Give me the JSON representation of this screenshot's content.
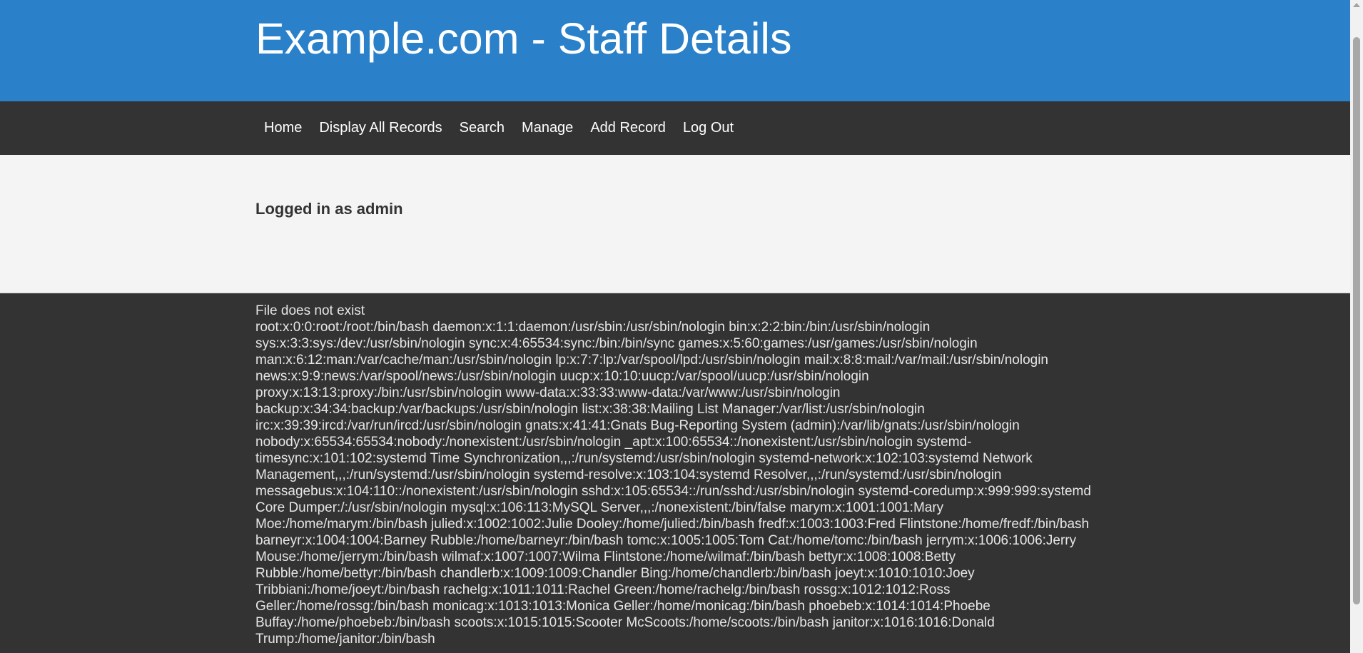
{
  "header": {
    "title": "Example.com - Staff Details"
  },
  "nav": {
    "items": [
      {
        "label": "Home"
      },
      {
        "label": "Display All Records"
      },
      {
        "label": "Search"
      },
      {
        "label": "Manage"
      },
      {
        "label": "Add Record"
      },
      {
        "label": "Log Out"
      }
    ]
  },
  "status": {
    "logged_in": "Logged in as admin"
  },
  "content": {
    "message": "File does not exist",
    "file_text": "root:x:0:0:root:/root:/bin/bash daemon:x:1:1:daemon:/usr/sbin:/usr/sbin/nologin bin:x:2:2:bin:/bin:/usr/sbin/nologin sys:x:3:3:sys:/dev:/usr/sbin/nologin sync:x:4:65534:sync:/bin:/bin/sync games:x:5:60:games:/usr/games:/usr/sbin/nologin man:x:6:12:man:/var/cache/man:/usr/sbin/nologin lp:x:7:7:lp:/var/spool/lpd:/usr/sbin/nologin mail:x:8:8:mail:/var/mail:/usr/sbin/nologin news:x:9:9:news:/var/spool/news:/usr/sbin/nologin uucp:x:10:10:uucp:/var/spool/uucp:/usr/sbin/nologin proxy:x:13:13:proxy:/bin:/usr/sbin/nologin www-data:x:33:33:www-data:/var/www:/usr/sbin/nologin backup:x:34:34:backup:/var/backups:/usr/sbin/nologin list:x:38:38:Mailing List Manager:/var/list:/usr/sbin/nologin irc:x:39:39:ircd:/var/run/ircd:/usr/sbin/nologin gnats:x:41:41:Gnats Bug-Reporting System (admin):/var/lib/gnats:/usr/sbin/nologin nobody:x:65534:65534:nobody:/nonexistent:/usr/sbin/nologin _apt:x:100:65534::/nonexistent:/usr/sbin/nologin systemd-timesync:x:101:102:systemd Time Synchronization,,,:/run/systemd:/usr/sbin/nologin systemd-network:x:102:103:systemd Network Management,,,:/run/systemd:/usr/sbin/nologin systemd-resolve:x:103:104:systemd Resolver,,,:/run/systemd:/usr/sbin/nologin messagebus:x:104:110::/nonexistent:/usr/sbin/nologin sshd:x:105:65534::/run/sshd:/usr/sbin/nologin systemd-coredump:x:999:999:systemd Core Dumper:/:/usr/sbin/nologin mysql:x:106:113:MySQL Server,,,:/nonexistent:/bin/false marym:x:1001:1001:Mary Moe:/home/marym:/bin/bash julied:x:1002:1002:Julie Dooley:/home/julied:/bin/bash fredf:x:1003:1003:Fred Flintstone:/home/fredf:/bin/bash barneyr:x:1004:1004:Barney Rubble:/home/barneyr:/bin/bash tomc:x:1005:1005:Tom Cat:/home/tomc:/bin/bash jerrym:x:1006:1006:Jerry Mouse:/home/jerrym:/bin/bash wilmaf:x:1007:1007:Wilma Flintstone:/home/wilmaf:/bin/bash bettyr:x:1008:1008:Betty Rubble:/home/bettyr:/bin/bash chandlerb:x:1009:1009:Chandler Bing:/home/chandlerb:/bin/bash joeyt:x:1010:1010:Joey Tribbiani:/home/joeyt:/bin/bash rachelg:x:1011:1011:Rachel Green:/home/rachelg:/bin/bash rossg:x:1012:1012:Ross Geller:/home/rossg:/bin/bash monicag:x:1013:1013:Monica Geller:/home/monicag:/bin/bash phoebeb:x:1014:1014:Phoebe Buffay:/home/phoebeb:/bin/bash scoots:x:1015:1015:Scooter McScoots:/home/scoots:/bin/bash janitor:x:1016:1016:Donald Trump:/home/janitor:/bin/bash"
  }
}
